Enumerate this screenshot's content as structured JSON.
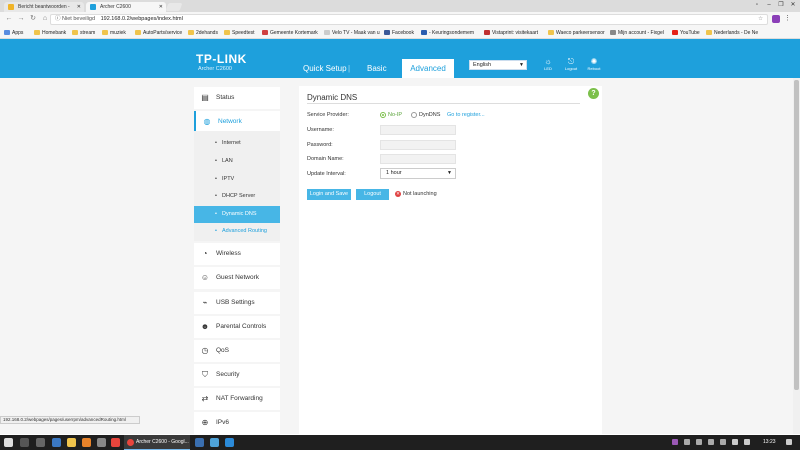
{
  "browser": {
    "tabs": [
      {
        "title": "Bericht beantwoorden - ",
        "active": false
      },
      {
        "title": "Archer C2600",
        "active": true
      }
    ],
    "address": {
      "security_label": "Niet beveiligd",
      "url": "192.168.0.2/webpages/index.html"
    },
    "bookmarks": [
      "Apps",
      "Homebank",
      "stream",
      "muziek",
      "AutoParts/service",
      "2dehands",
      "Speedtest",
      "Gemeente Kortemark",
      "Velo TV - Maak van u",
      "Facebook",
      "- Keuringsondemem",
      "Vistaprint: visitekaart",
      "Waeco parkeersensor",
      "Mijn account - Fixgel",
      "YouTube",
      "Nederlands - De Ne"
    ],
    "status_url": "192.168.0.2/webpages/pages/userrpm/advancedRouting.html"
  },
  "router": {
    "brand": "TP-LINK",
    "model": "Archer C2600",
    "nav": {
      "quick_setup": "Quick Setup",
      "basic": "Basic",
      "advanced": "Advanced"
    },
    "language": "English",
    "header_icons": {
      "led": "LED",
      "logout": "Logout",
      "reboot": "Reboot"
    }
  },
  "sidebar": {
    "items": [
      {
        "label": "Status",
        "icon": "status-icon"
      },
      {
        "label": "Network",
        "icon": "globe-icon"
      },
      {
        "label": "Wireless",
        "icon": "wifi-icon"
      },
      {
        "label": "Guest Network",
        "icon": "guest-icon"
      },
      {
        "label": "USB Settings",
        "icon": "usb-icon"
      },
      {
        "label": "Parental Controls",
        "icon": "parental-icon"
      },
      {
        "label": "QoS",
        "icon": "qos-icon"
      },
      {
        "label": "Security",
        "icon": "shield-icon"
      },
      {
        "label": "NAT Forwarding",
        "icon": "nat-icon"
      },
      {
        "label": "IPv6",
        "icon": "ipv6-icon"
      }
    ],
    "network_sub": [
      "Internet",
      "LAN",
      "IPTV",
      "DHCP Server",
      "Dynamic DNS",
      "Advanced Routing"
    ]
  },
  "ddns": {
    "title": "Dynamic DNS",
    "service_provider_label": "Service Provider:",
    "providers": [
      "No-IP",
      "DynDNS"
    ],
    "selected_provider": "No-IP",
    "go_register": "Go to register...",
    "username_label": "Username:",
    "password_label": "Password:",
    "domain_label": "Domain Name:",
    "interval_label": "Update Interval:",
    "interval_value": "1 hour",
    "login_button": "Login and Save",
    "logout_button": "Logout",
    "status_text": "Not launching"
  },
  "taskbar": {
    "task": "Archer C2600 - Googl...",
    "time": "13:23"
  }
}
